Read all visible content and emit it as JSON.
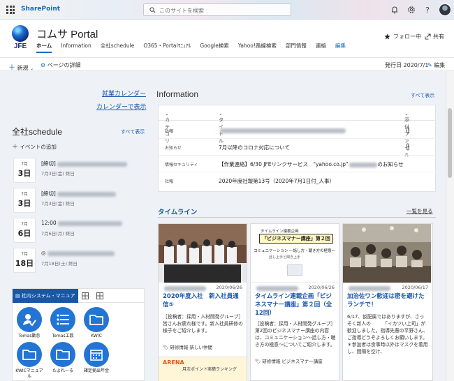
{
  "suitebar": {
    "brand": "SharePoint",
    "search_placeholder": "このサイトを検索"
  },
  "site": {
    "logo_text": "JFE",
    "title": "コムサ Portal"
  },
  "nav": [
    "ホーム",
    "Information",
    "全社schedule",
    "O365・Portalﾏﾆｭｱﾙ",
    "Google検索",
    "Yahoo!路線検索",
    "部門情報",
    "連絡",
    "編集"
  ],
  "header_actions": {
    "follow": "フォロー中",
    "share": "共有"
  },
  "cmdbar": {
    "new": "新規",
    "page_details": "ページの詳細",
    "published": "発行日 2020/7/1",
    "edit": "編集"
  },
  "left_links": {
    "work_calendar": "就業カレンダー",
    "calendar_view": "カレンダーで表示"
  },
  "schedule": {
    "title": "全社schedule",
    "see_all": "すべて表示",
    "add_event": "イベントの追加",
    "events": [
      {
        "month": "7月",
        "day": "3日",
        "title": "[締切]",
        "sub": "7月3日(金) 終日"
      },
      {
        "month": "7月",
        "day": "3日",
        "title": "[締切]",
        "sub": "7月3日(金) 終日"
      },
      {
        "month": "7月",
        "day": "6日",
        "title": "12:00",
        "sub": "7月6日(月) 終日"
      },
      {
        "month": "7月",
        "day": "18日",
        "title": "◎",
        "sub": "7月18日(土) 終日"
      }
    ]
  },
  "apps": {
    "tab_active": "社内システム・マニュアル類",
    "items": [
      {
        "label": "Tomas勤怠",
        "icon": "person-check-icon"
      },
      {
        "label": "Tomas工数",
        "icon": "list-icon"
      },
      {
        "label": "KWIC",
        "icon": "folder-icon"
      },
      {
        "label": "KWICマニュアル",
        "icon": "folder-icon"
      },
      {
        "label": "たよれーる",
        "icon": "folder-icon"
      },
      {
        "label": "確定拠出年金",
        "icon": "calendar-icon"
      }
    ]
  },
  "information": {
    "title": "Information",
    "see_all": "すべて表示",
    "columns": {
      "category": "カテゴリ",
      "title": "タイトル",
      "attachments": "添付ファイル"
    },
    "rows": [
      {
        "category": "訃報",
        "title": "",
        "has_attachment": true
      },
      {
        "category": "お知らせ",
        "title": "7月以降のコロナ対応について",
        "has_attachment": true
      },
      {
        "category": "情報セキュリティ",
        "title": "【作業連絡】6/30 JFEリンクサービス　\"yahoo.co.jp\"",
        "title_tail": "のお知らせ",
        "has_attachment": false
      },
      {
        "category": "社報",
        "title": "2020年度社報第13号（2020年7月1日付_人事）",
        "has_attachment": false
      }
    ]
  },
  "timeline": {
    "title": "タイムライン",
    "see_all": "一覧を見る",
    "cards": [
      {
        "date": "2020/06/26",
        "title": "2020年度入社　新入社員通信⑤",
        "body": "［投稿者：採用・人材開発グループ］皆さんお疲れ様です。新入社員研修の様子をご紹介します。",
        "tag": "研修情報 新しい仲間"
      },
      {
        "date": "2020/06/26",
        "title": "タイムライン連載企画「ビジネスマナー講座」第２回（全12回）",
        "body": "［投稿者：採用・人材開発グループ］第2回のビジネスマナー講座の内容は、コミュニケーション～話し方・聴き方の極意～についてご紹介します。",
        "tag": "研修情報 ビジネスマナー講座"
      },
      {
        "date": "2020/06/17",
        "title": "加治佐ワン歓迎は密を避けたランチで！",
        "body": "6/17、仮配属ではありますが、さっそく新人の　　　「イカツい上司」が歓迎しました。指導先輩の平野さん、ご指導どうぞよろしくお願いします。＊参加者は食事時以外はマスクを着用し、間隔を空け、"
      }
    ],
    "poster": {
      "line1": "タイムライン連載企画",
      "line2": "「ビジネスマナー講座」第２回",
      "line3": "コミュニケーション ～話し方・聴き方の極意～",
      "line4": "話し上手と聞き上手"
    },
    "next_banner": {
      "brand": "ARENA",
      "text": "月次ポイント実績ランキング"
    }
  }
}
